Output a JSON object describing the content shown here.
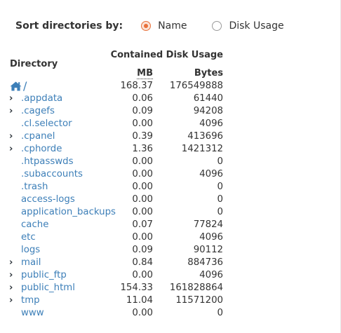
{
  "sort": {
    "label": "Sort directories by:",
    "options": [
      {
        "label": "Name",
        "checked": true
      },
      {
        "label": "Disk Usage",
        "checked": false
      }
    ]
  },
  "table": {
    "col_directory": "Directory",
    "col_group": "Contained Disk Usage",
    "col_mb": "MB",
    "col_bytes": "Bytes",
    "root": {
      "name": "/",
      "mb": "168.37",
      "bytes": "176549888",
      "icon": "home-icon"
    },
    "rows": [
      {
        "name": ".appdata",
        "mb": "0.06",
        "bytes": "61440",
        "expandable": true
      },
      {
        "name": ".cagefs",
        "mb": "0.09",
        "bytes": "94208",
        "expandable": true
      },
      {
        "name": ".cl.selector",
        "mb": "0.00",
        "bytes": "4096",
        "expandable": false
      },
      {
        "name": ".cpanel",
        "mb": "0.39",
        "bytes": "413696",
        "expandable": true
      },
      {
        "name": ".cphorde",
        "mb": "1.36",
        "bytes": "1421312",
        "expandable": true
      },
      {
        "name": ".htpasswds",
        "mb": "0.00",
        "bytes": "0",
        "expandable": false
      },
      {
        "name": ".subaccounts",
        "mb": "0.00",
        "bytes": "4096",
        "expandable": false
      },
      {
        "name": ".trash",
        "mb": "0.00",
        "bytes": "0",
        "expandable": false
      },
      {
        "name": "access-logs",
        "mb": "0.00",
        "bytes": "0",
        "expandable": false
      },
      {
        "name": "application_backups",
        "mb": "0.00",
        "bytes": "0",
        "expandable": false
      },
      {
        "name": "cache",
        "mb": "0.07",
        "bytes": "77824",
        "expandable": false
      },
      {
        "name": "etc",
        "mb": "0.00",
        "bytes": "4096",
        "expandable": false
      },
      {
        "name": "logs",
        "mb": "0.09",
        "bytes": "90112",
        "expandable": false
      },
      {
        "name": "mail",
        "mb": "0.84",
        "bytes": "884736",
        "expandable": true
      },
      {
        "name": "public_ftp",
        "mb": "0.00",
        "bytes": "4096",
        "expandable": true
      },
      {
        "name": "public_html",
        "mb": "154.33",
        "bytes": "161828864",
        "expandable": true
      },
      {
        "name": "tmp",
        "mb": "11.04",
        "bytes": "11571200",
        "expandable": true
      },
      {
        "name": "www",
        "mb": "0.00",
        "bytes": "0",
        "expandable": false
      }
    ]
  },
  "colors": {
    "link": "#3d7fb8",
    "radio_accent": "#e8703a",
    "text": "#333333"
  }
}
